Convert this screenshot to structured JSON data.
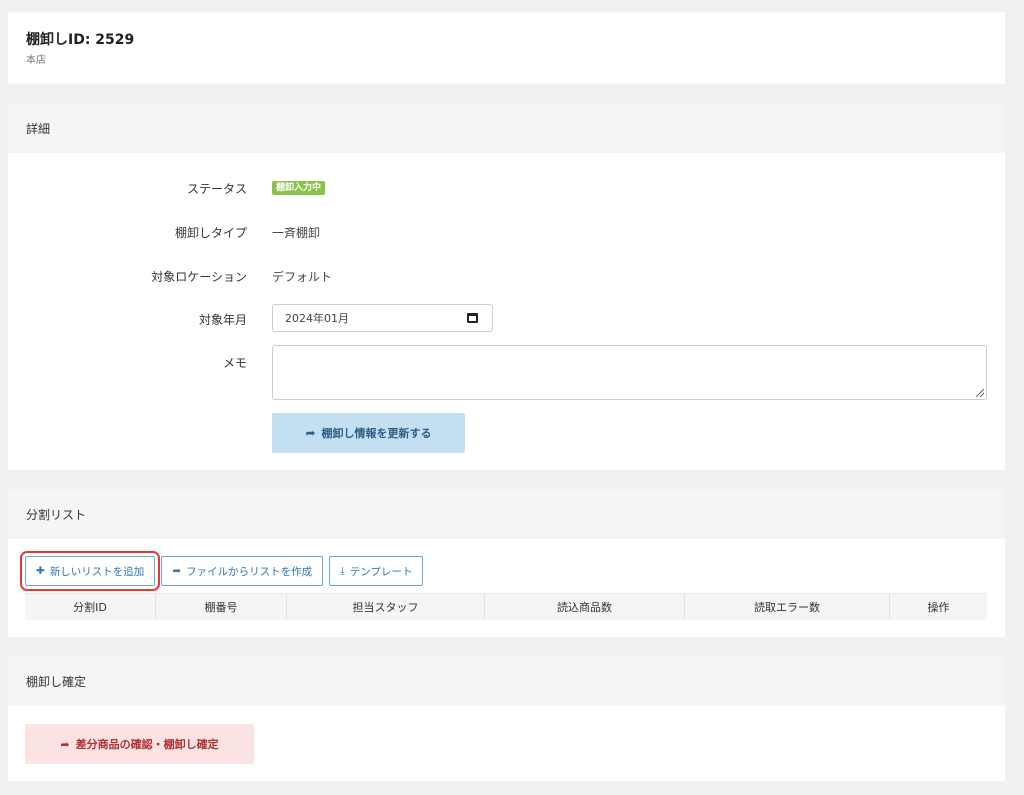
{
  "header": {
    "title": "棚卸しID: 2529",
    "subtitle": "本店"
  },
  "details": {
    "section_title": "詳細",
    "status_label": "ステータス",
    "status_badge": "棚卸入力中",
    "type_label": "棚卸しタイプ",
    "type_value": "一斉棚卸",
    "location_label": "対象ロケーション",
    "location_value": "デフォルト",
    "month_label": "対象年月",
    "month_value": "2024年01月",
    "memo_label": "メモ",
    "memo_value": "",
    "update_button": "棚卸し情報を更新する"
  },
  "split_list": {
    "section_title": "分割リスト",
    "add_button": "新しいリストを追加",
    "from_file_button": "ファイルからリストを作成",
    "template_button": "テンプレート",
    "columns": [
      "分割ID",
      "棚番号",
      "担当スタッフ",
      "読込商品数",
      "読取エラー数",
      "操作"
    ]
  },
  "finalize": {
    "section_title": "棚卸し確定",
    "confirm_button": "差分商品の確認・棚卸し確定"
  },
  "colors": {
    "badge": "#8bc34a",
    "primary_light": "#c5dff2",
    "danger_light": "#fbe3e3",
    "highlight": "#e53935"
  },
  "icons": {
    "plus": "plus-icon",
    "share": "share-icon",
    "download": "download-icon",
    "calendar": "calendar-icon"
  }
}
